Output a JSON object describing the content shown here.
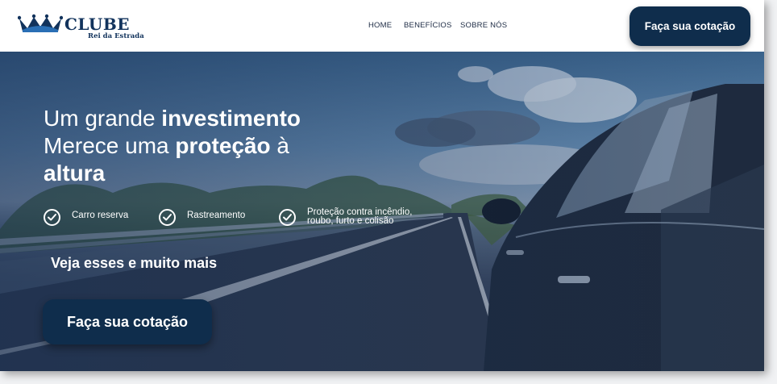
{
  "brand": {
    "name": "CLUBE",
    "tagline": "Rei da Estrada",
    "crown_icon": "crown-icon",
    "color": "#12335c"
  },
  "nav": {
    "items": [
      {
        "label": "HOME"
      },
      {
        "label": "BENEFÍCIOS"
      },
      {
        "label": "SOBRE NÓS"
      }
    ]
  },
  "header": {
    "cta_label": "Faça sua cotação"
  },
  "hero": {
    "headline": {
      "line1_regular": "Um grande ",
      "line1_bold": "investimento",
      "line2_regular": "Merece uma ",
      "line2_bold": "proteção",
      "line2_tail": " à",
      "line3_bold": "altura"
    },
    "features": [
      {
        "label": "Carro reserva",
        "icon": "check-circle-icon"
      },
      {
        "label": "Rastreamento",
        "icon": "check-circle-icon"
      },
      {
        "label": "Proteção contra incêndio, roubo, furto e colisão",
        "icon": "check-circle-icon"
      }
    ],
    "more_text": "Veja esses e muito mais",
    "cta_label": "Faça sua cotação"
  },
  "colors": {
    "primary": "#0f2d4c",
    "text_on_primary": "#ffffff",
    "nav_text": "#1d2b44"
  }
}
